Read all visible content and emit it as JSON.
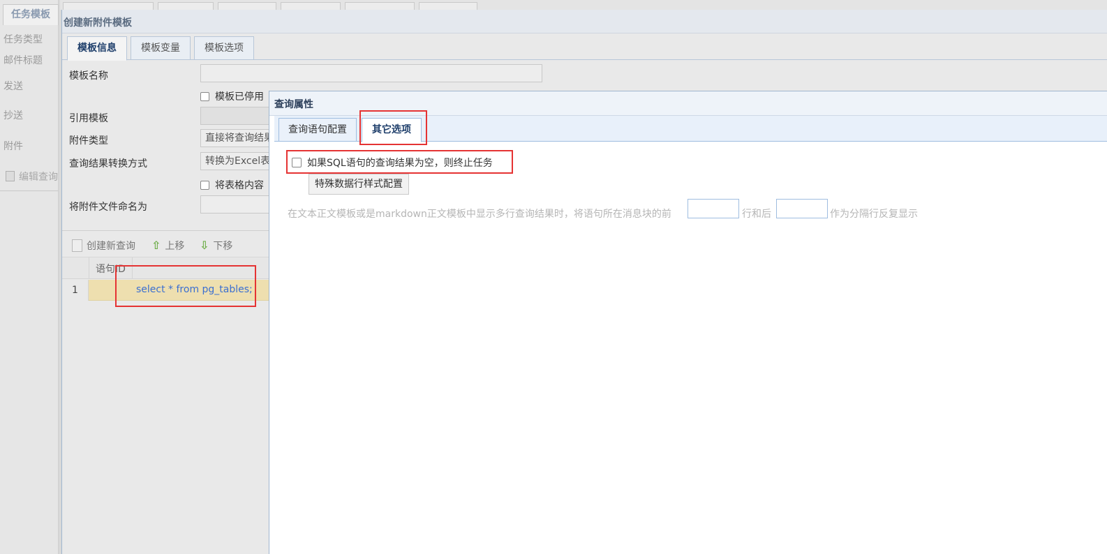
{
  "left_sidebar": {
    "tab": "任务模板",
    "items": [
      "任务类型",
      "邮件标题",
      "发送",
      "抄送",
      "附件"
    ],
    "edit_query": "编辑查询"
  },
  "window_main": {
    "title": "创建新附件模板",
    "tabs": [
      "模板信息",
      "模板变量",
      "模板选项"
    ],
    "active_tab": "模板信息",
    "form": {
      "template_name_label": "模板名称",
      "template_name_value": "",
      "template_disabled_label": "模板已停用",
      "reference_template_label": "引用模板",
      "attachment_type_label": "附件类型",
      "attachment_type_value": "直接将查询结果",
      "result_convert_label": "查询结果转换方式",
      "result_convert_value": "转换为Excel表",
      "table_content_label": "将表格内容",
      "attachment_filename_label": "将附件文件命名为",
      "attachment_filename_value": ""
    },
    "toolbar": {
      "create_query": "创建新查询",
      "move_up": "上移",
      "move_down": "下移"
    },
    "grid": {
      "header_stmt_id": "语句ID",
      "rows": [
        {
          "num": "1",
          "stmt_id": "",
          "sql": "select * from pg_tables;"
        }
      ]
    }
  },
  "window_query": {
    "title": "查询属性",
    "tabs": [
      "查询语句配置",
      "其它选项"
    ],
    "active_tab": "其它选项",
    "terminate_if_empty_label": "如果SQL语句的查询结果为空，则终止任务",
    "special_row_style_button": "特殊数据行样式配置",
    "row_text_before": "在文本正文模板或是markdown正文模板中显示多行查询结果时，将语句所在消息块的前",
    "row_text_middle": "行和后",
    "row_text_after": "作为分隔行反复显示",
    "rows_before_value": "",
    "rows_after_value": ""
  },
  "colors": {
    "highlight": "#e53333",
    "accent": "#9fbde0",
    "sql_text": "#3b6fd1",
    "selected_row": "#eedfaf"
  }
}
